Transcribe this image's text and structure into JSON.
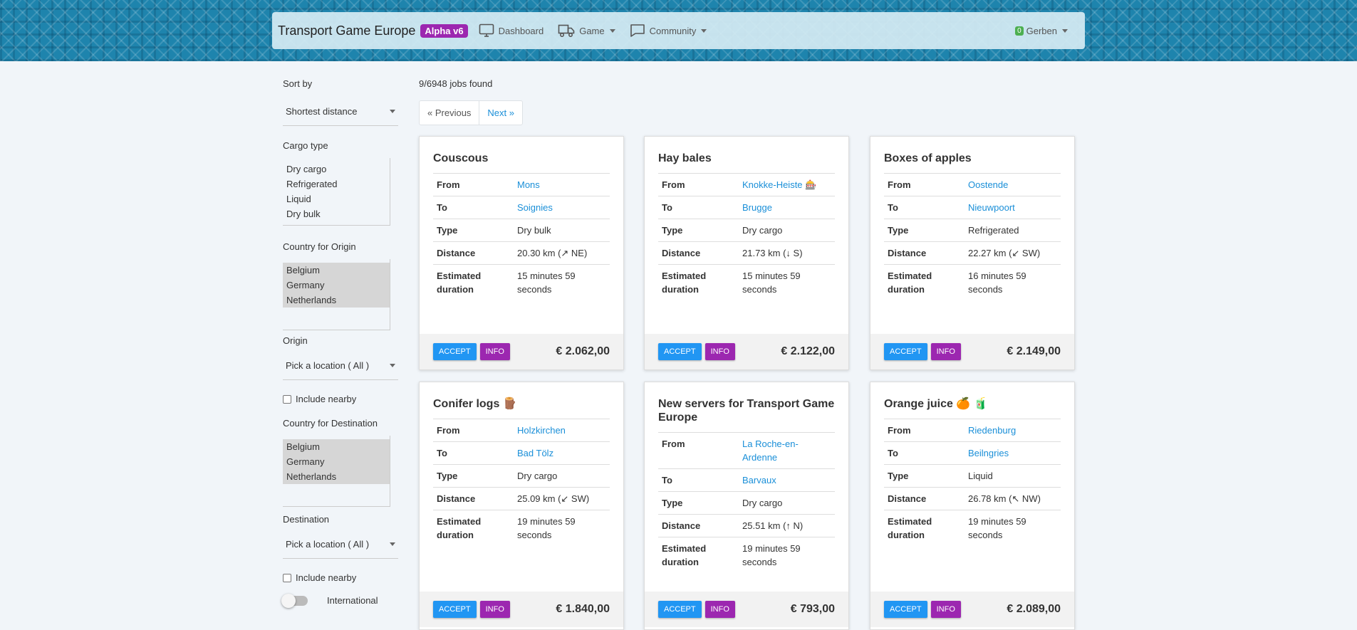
{
  "navbar": {
    "brand": "Transport Game Europe",
    "badge": "Alpha v6",
    "items": [
      "Dashboard",
      "Game",
      "Community"
    ],
    "user_count": "0",
    "user_name": "Gerben"
  },
  "sidebar": {
    "sort_label": "Sort by",
    "sort_value": "Shortest distance",
    "cargo_label": "Cargo type",
    "cargo_options": [
      "Dry cargo",
      "Refrigerated",
      "Liquid",
      "Dry bulk"
    ],
    "origin_country_label": "Country for Origin",
    "origin_countries": [
      "Belgium",
      "Germany",
      "Netherlands"
    ],
    "origin_label": "Origin",
    "origin_value": "Pick a location ( All )",
    "include_nearby": "Include nearby",
    "dest_country_label": "Country for Destination",
    "dest_countries": [
      "Belgium",
      "Germany",
      "Netherlands"
    ],
    "dest_label": "Destination",
    "dest_value": "Pick a location ( All )",
    "international": "International"
  },
  "results": {
    "found": "9/6948 jobs found",
    "prev": "« Previous",
    "next": "Next »"
  },
  "labels": {
    "from": "From",
    "to": "To",
    "type": "Type",
    "distance": "Distance",
    "duration": "Estimated duration",
    "accept": "ACCEPT",
    "info": "INFO"
  },
  "jobs": [
    {
      "title": "Couscous",
      "from": "Mons",
      "to": "Soignies",
      "type": "Dry bulk",
      "distance": "20.30 km (↗ NE)",
      "duration": "15 minutes 59 seconds",
      "price": "€ 2.062,00"
    },
    {
      "title": "Hay bales",
      "from": "Knokke-Heiste 🎰",
      "to": "Brugge",
      "type": "Dry cargo",
      "distance": "21.73 km (↓ S)",
      "duration": "15 minutes 59 seconds",
      "price": "€ 2.122,00"
    },
    {
      "title": "Boxes of apples",
      "from": "Oostende",
      "to": "Nieuwpoort",
      "type": "Refrigerated",
      "distance": "22.27 km (↙ SW)",
      "duration": "16 minutes 59 seconds",
      "price": "€ 2.149,00"
    },
    {
      "title": "Conifer logs 🪵",
      "from": "Holzkirchen",
      "to": "Bad Tölz",
      "type": "Dry cargo",
      "distance": "25.09 km (↙ SW)",
      "duration": "19 minutes 59 seconds",
      "price": "€ 1.840,00"
    },
    {
      "title": "New servers for Transport Game Europe",
      "from": "La Roche-en-Ardenne",
      "to": "Barvaux",
      "type": "Dry cargo",
      "distance": "25.51 km (↑ N)",
      "duration": "19 minutes 59 seconds",
      "price": "€ 793,00"
    },
    {
      "title": "Orange juice 🍊 🧃",
      "from": "Riedenburg",
      "to": "Beilngries",
      "type": "Liquid",
      "distance": "26.78 km (↖ NW)",
      "duration": "19 minutes 59 seconds",
      "price": "€ 2.089,00"
    }
  ]
}
